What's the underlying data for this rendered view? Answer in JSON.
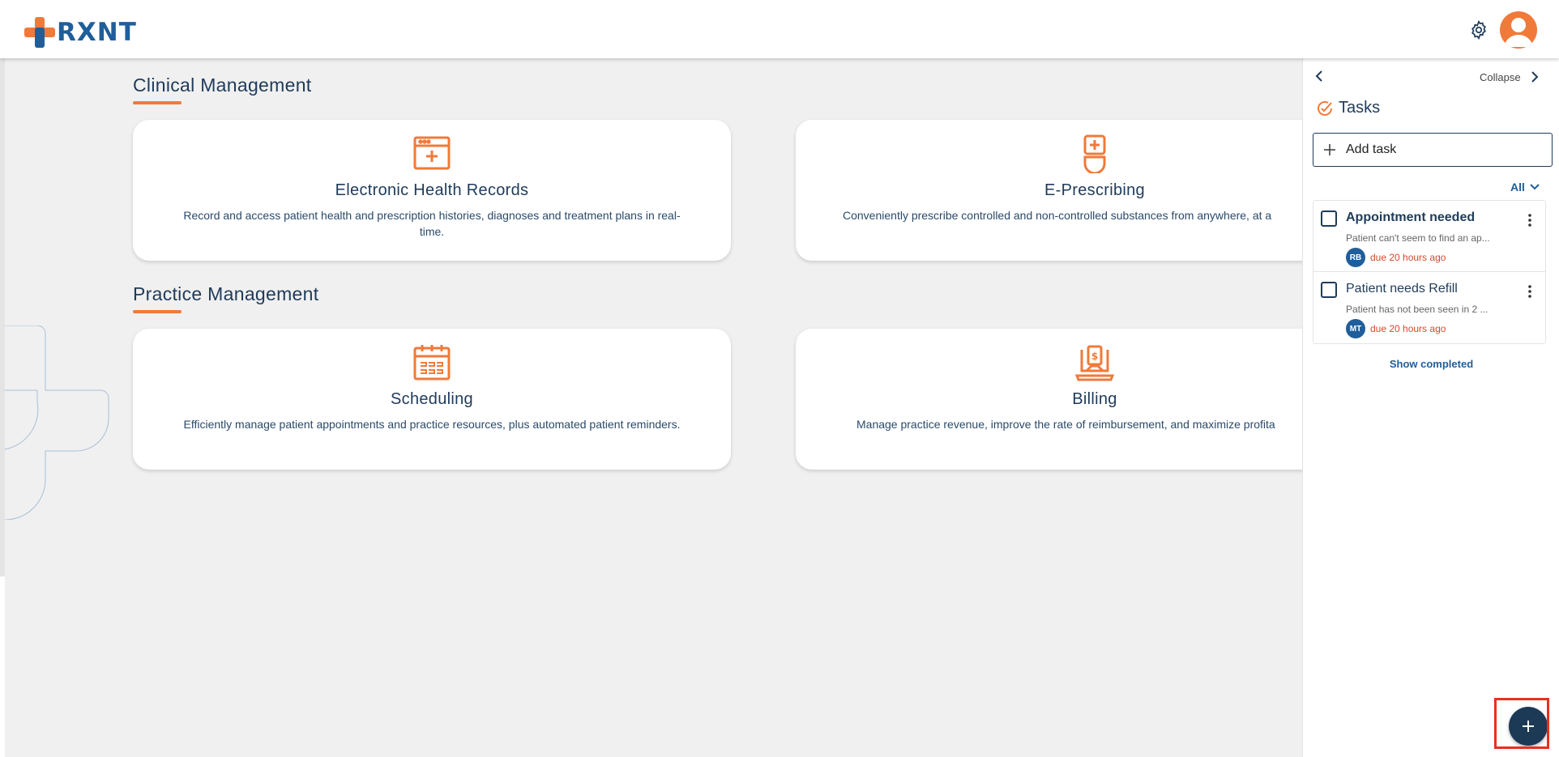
{
  "app": {
    "logo_text": "RXNT"
  },
  "colors": {
    "brand_orange": "#f07a3a",
    "brand_blue": "#1f5e9a",
    "navy": "#1f3b5a",
    "due_red": "#d44a2a",
    "highlight_red": "#e8301c"
  },
  "header": {
    "settings_icon": "gear-icon",
    "avatar_icon": "user-avatar-icon"
  },
  "sections": [
    {
      "title": "Clinical Management",
      "cards": [
        {
          "icon": "ehr-window-plus-icon",
          "title": "Electronic Health Records",
          "description": "Record and access patient health and prescription histories, diagnoses and treatment plans in real-time."
        },
        {
          "icon": "prescription-bottle-icon",
          "title": "E-Prescribing",
          "description": "Conveniently prescribe controlled and non-controlled substances from anywhere, at a"
        }
      ]
    },
    {
      "title": "Practice Management",
      "cards": [
        {
          "icon": "calendar-icon",
          "title": "Scheduling",
          "description": "Efficiently manage patient appointments and practice resources, plus automated patient reminders."
        },
        {
          "icon": "laptop-dollar-icon",
          "title": "Billing",
          "description": "Manage practice revenue, improve the rate of reimbursement, and maximize profita"
        }
      ]
    }
  ],
  "tasks_panel": {
    "collapse_label": "Collapse",
    "title": "Tasks",
    "add_task_placeholder": "Add task",
    "filter_label": "All",
    "items": [
      {
        "title": "Appointment needed",
        "description": "Patient can't seem to find an ap...",
        "initials": "RB",
        "due": "due 20 hours ago",
        "checked": false,
        "bold": true
      },
      {
        "title": "Patient needs Refill",
        "description": "Patient has not been seen in 2 ...",
        "initials": "MT",
        "due": "due 20 hours ago",
        "checked": false,
        "bold": false
      }
    ],
    "show_completed_label": "Show completed"
  },
  "fab": {
    "icon": "plus-icon"
  }
}
